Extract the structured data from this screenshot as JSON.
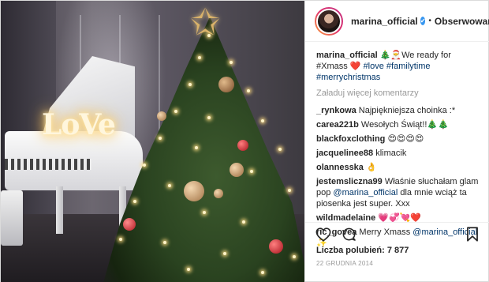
{
  "post": {
    "photo_alt": "Christmas tree next to white piano",
    "love_sign": "LoVe"
  },
  "header": {
    "username": "marina_official",
    "verified_glyph": "✔",
    "separator": "•",
    "follow_label": "Obserwowanie"
  },
  "caption": {
    "user": "marina_official",
    "text": " 🎄🎅We ready for #Xmass ❤️",
    "tags": "#love #familytime #merrychristmas"
  },
  "load_more": "Załaduj więcej komentarzy",
  "comments": [
    {
      "user": "_rynkowa",
      "text": " Najpiękniejsza choinka :*"
    },
    {
      "user": "carea221b",
      "text": " Wesołych Świąt!!🎄🎄"
    },
    {
      "user": "blackfoxclothing",
      "text": " 😍😍😍😍"
    },
    {
      "user": "jacquelinee88",
      "text": " klimacik"
    },
    {
      "user": "olannesska",
      "text": " 👌"
    },
    {
      "user": "jestemsliczna99",
      "text": " Właśnie słuchałam glam pop ",
      "mention": "@marina_official",
      "text_after": " dla mnie wciąż ta piosenka jest super. Xxx"
    },
    {
      "user": "wildmadelaine",
      "text": " 💗💞💘❤️"
    },
    {
      "user": "ric_govea",
      "text": " Merry Xmass ",
      "mention": "@marina_official",
      "text_after": " ✨"
    }
  ],
  "actions": {
    "like_icon": "heart-icon",
    "comment_icon": "comment-icon",
    "save_icon": "bookmark-icon"
  },
  "likes": "Liczba polubień: 7 877",
  "date": "22 GRUDNIA 2014",
  "colors": {
    "link": "#003569",
    "verified": "#3897f0",
    "muted": "#999999",
    "text": "#262626"
  }
}
